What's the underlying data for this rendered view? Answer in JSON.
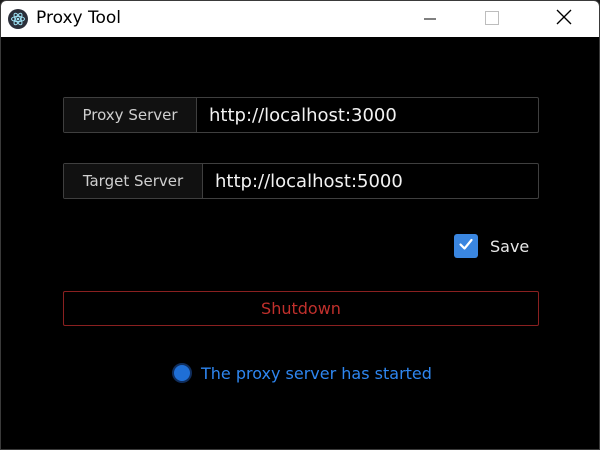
{
  "window": {
    "title": "Proxy Tool"
  },
  "fields": {
    "proxy": {
      "label": "Proxy Server",
      "value": "http://localhost:3000"
    },
    "target": {
      "label": "Target Server",
      "value": "http://localhost:5000"
    }
  },
  "save": {
    "label": "Save",
    "checked": true
  },
  "shutdown": {
    "label": "Shutdown"
  },
  "status": {
    "text": "The proxy server has started"
  },
  "colors": {
    "accent": "#3a86e0",
    "danger": "#c0302c",
    "status": "#2e86f0",
    "background": "#000000"
  },
  "icons": {
    "app": "electron-icon",
    "minimize": "minimize-icon",
    "maximize": "maximize-icon",
    "close": "close-icon",
    "check": "check-icon"
  }
}
